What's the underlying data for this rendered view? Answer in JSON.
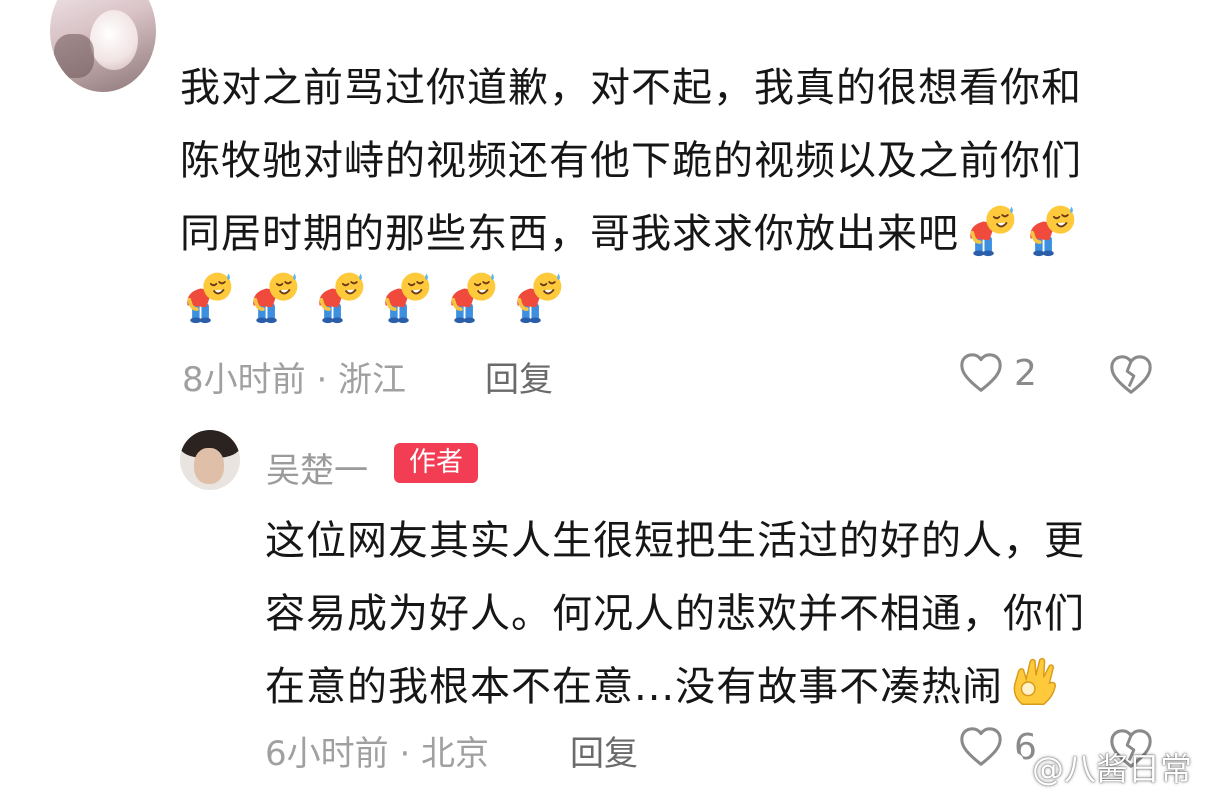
{
  "comment": {
    "lines": [
      "我对之前骂过你道歉，对不起，我真的很想看你和",
      "陈牧驰对峙的视频还有他下跪的视频以及之前你们",
      "同居时期的那些东西，哥我求求你放出来吧"
    ],
    "emoji": "bowing-emoji",
    "meta": "8小时前 · 浙江",
    "reply_label": "回复",
    "like_count": "2"
  },
  "reply": {
    "author": "吴楚一",
    "badge": "作者",
    "lines": [
      "这位网友其实人生很短把生活过的好的人，更",
      "容易成为好人。何况人的悲欢并不相通，你们",
      "在意的我根本不在意...没有故事不凑热闹"
    ],
    "emoji": "ok-hand-emoji",
    "meta": "6小时前 · 北京",
    "reply_label": "回复",
    "like_count": "6"
  },
  "watermark": {
    "text": "@八酱日常"
  },
  "colors": {
    "badge": "#f23d55",
    "meta": "#a0a0a0",
    "icon": "#8a8a8a"
  }
}
